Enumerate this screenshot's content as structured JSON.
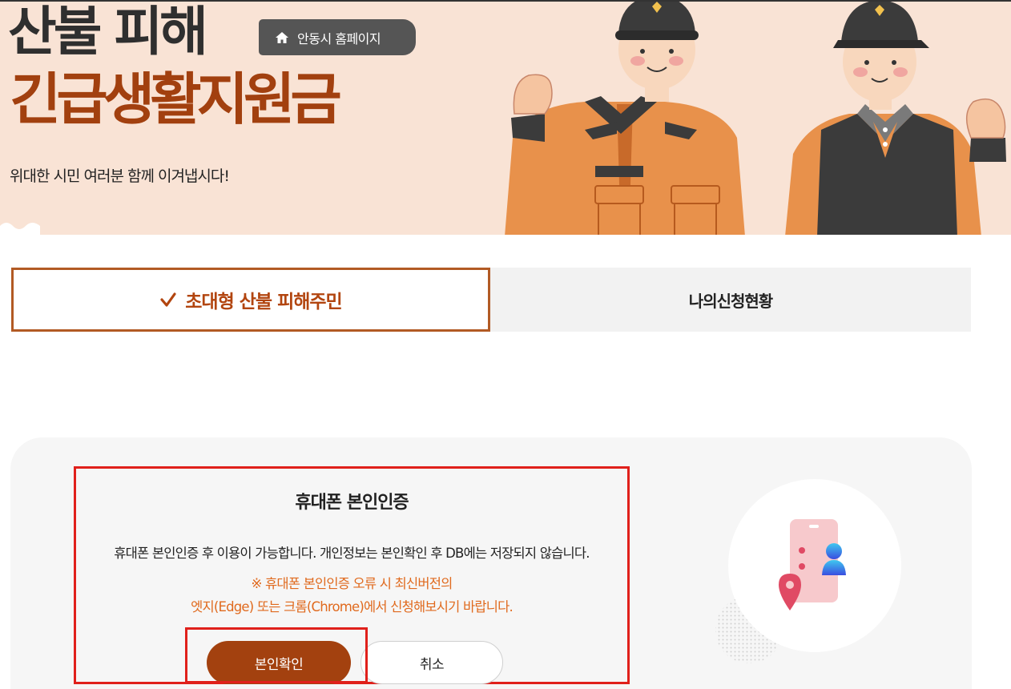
{
  "hero": {
    "title_line1": "산불 피해",
    "title_line2": "긴급생활지원금",
    "subtitle": "위대한 시민 여러분 함께 이겨냅시다!",
    "home_button_label": "안동시 홈페이지",
    "home_icon": "home-icon",
    "illustration": "firefighter-characters",
    "colors": {
      "background": "#f9e3d5",
      "title_accent": "#a2400f"
    }
  },
  "tabs": [
    {
      "label": "초대형 산불 피해주민",
      "active": true,
      "icon": "check-icon"
    },
    {
      "label": "나의신청현황",
      "active": false
    }
  ],
  "auth": {
    "title": "휴대폰 본인인증",
    "description": "휴대폰 본인인증 후 이용이 가능합니다. 개인정보는 본인확인 후 DB에는 저장되지 않습니다.",
    "warning_line1": "※ 휴대폰 본인인증 오류 시 최신버전의",
    "warning_line2": "엣지(Edge) 또는 크롬(Chrome)에서 신청해보시기 바랍니다.",
    "confirm_label": "본인확인",
    "cancel_label": "취소",
    "illustration": "phone-verification-icon",
    "colors": {
      "confirm": "#a3410f",
      "warning": "#e06a1e",
      "highlight": "#e0201b"
    }
  }
}
